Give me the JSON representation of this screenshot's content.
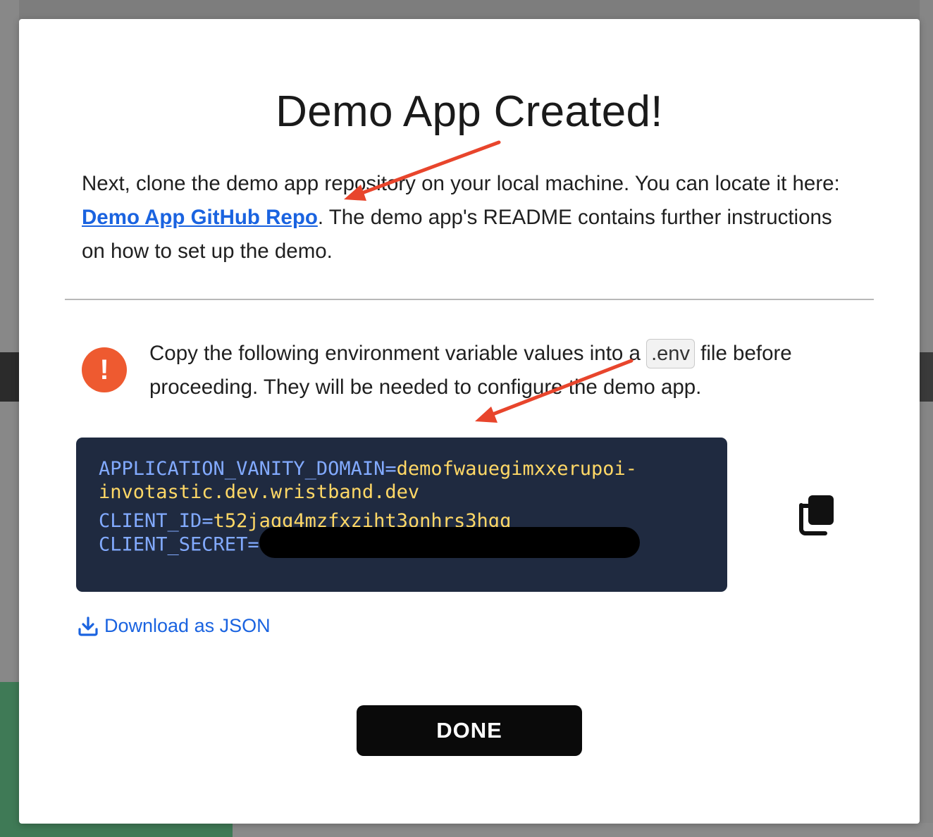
{
  "modal": {
    "title": "Demo App Created!",
    "intro_before": "Next, clone the demo app repository on your local machine. You can locate it here: ",
    "repo_link": "Demo App GitHub Repo",
    "intro_after": ". The demo app's README contains further instructions on how to set up the demo.",
    "warning_before": "Copy the following environment variable values into a ",
    "env_chip": ".env",
    "warning_after": " file before proceeding. They will be needed to configure the demo app.",
    "env": {
      "domain_key": "APPLICATION_VANITY_DOMAIN",
      "domain_value_1": "demofwauegimxxerupoi-",
      "domain_value_2": "invotastic.dev.wristband.dev",
      "client_id_key": "CLIENT_ID",
      "client_id_value": "t52jaqg4mzfxziht3onhrs3hgq",
      "client_secret_key": "CLIENT_SECRET"
    },
    "download_label": "Download as JSON",
    "done_label": "DONE"
  },
  "colors": {
    "link": "#1a63e0",
    "warning": "#ee5a30",
    "code_bg": "#1f2a40",
    "code_key": "#82aaff",
    "code_value": "#ffd866",
    "annotation_arrow": "#e8452c"
  }
}
